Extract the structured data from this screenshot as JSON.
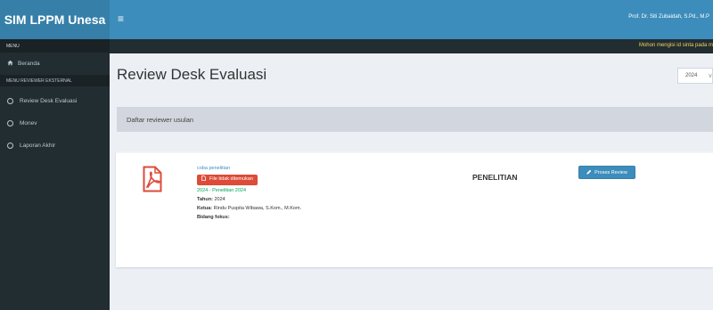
{
  "app": {
    "title": "SIM LPPM Unesa"
  },
  "topbar": {
    "toggle_icon": "≡",
    "user_name": "Prof. Dr. Siti Zubaidah, S.Pd., M.P"
  },
  "notice": {
    "text": "Mohon mengisi id sinta pada m"
  },
  "sidebar": {
    "menu_header": "MENU",
    "home": {
      "label": "Beranda",
      "icon": "home-icon"
    },
    "section": "MENU REVIEWER EKSTERNAL",
    "items": [
      {
        "label": "Review Desk Evaluasi",
        "icon": "circle-icon"
      },
      {
        "label": "Monev",
        "icon": "circle-icon"
      },
      {
        "label": "Laporan Akhir",
        "icon": "circle-icon"
      }
    ]
  },
  "main": {
    "title": "Review Desk Evaluasi",
    "year_select": {
      "value": "2024"
    },
    "box_title": "Daftar reviewer usulan",
    "proposal": {
      "title_link": "coba penelitian",
      "file_badge": "File tidak ditemukan",
      "scheme": "2024 - Penelitian 2024",
      "tahun_label": "Tahun:",
      "tahun_value": "2024",
      "ketua_label": "Ketua:",
      "ketua_value": "Rindu Puspita Wibawa, S.Kom., M.Kom.",
      "bidang_label": "Bidang fokus:",
      "bidang_value": "",
      "category": "PENELITIAN",
      "action_label": "Proses Review"
    }
  },
  "colors": {
    "header": "#3c8dbc",
    "logo_bg": "#367fa9",
    "sidebar": "#222d32",
    "danger": "#dd4b39",
    "success": "#00a65a",
    "notice_text": "#f3d35a"
  }
}
